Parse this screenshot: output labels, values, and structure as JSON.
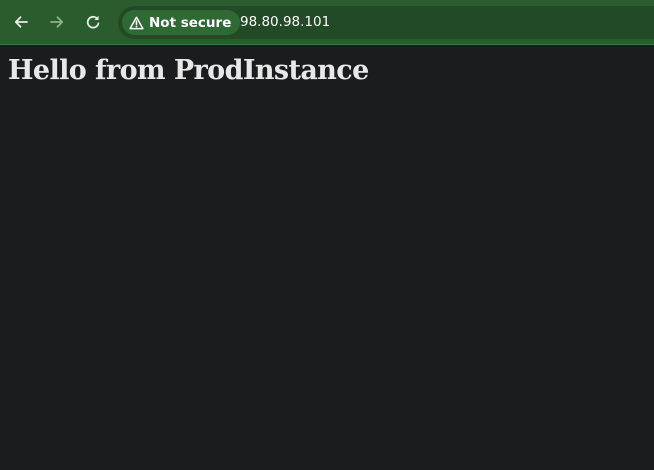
{
  "browser": {
    "nav": {
      "back_icon": "arrow-left-icon",
      "forward_icon": "arrow-right-icon",
      "reload_icon": "reload-icon"
    },
    "omnibox": {
      "security_icon": "warning-triangle-icon",
      "security_label": "Not secure",
      "url": "98.80.98.101"
    },
    "colors": {
      "toolbar": "#2a5c2e",
      "omnibox": "#224a26",
      "page_background": "#1b1c1e"
    }
  },
  "page": {
    "heading": "Hello from ProdInstance"
  }
}
